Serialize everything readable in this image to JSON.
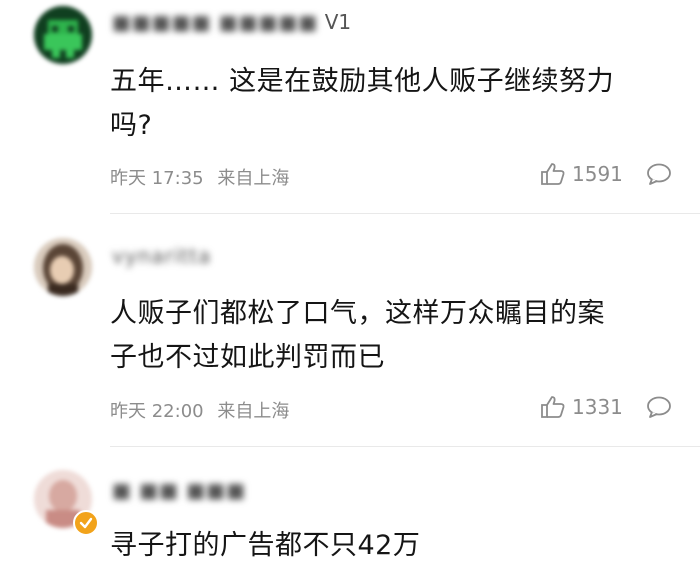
{
  "comments": [
    {
      "username_blurred": "■■■■■ ■■■■■",
      "username_suffix": "V1",
      "text_line1": "五年…… 这是在鼓励其他人贩子继续努力",
      "text_line2": "吗?",
      "time": "昨天 17:35",
      "source": "来自上海",
      "likes": "1591",
      "avatar_icon": "pixel-avatar-green"
    },
    {
      "username_blurred": "vynaritta",
      "username_suffix": "",
      "text_line1": "人贩子们都松了口气，这样万众瞩目的案",
      "text_line2": "子也不过如此判罚而已",
      "time": "昨天 22:00",
      "source": "来自上海",
      "likes": "1331",
      "avatar_icon": "photo-avatar-blurred"
    },
    {
      "username_blurred": "■ ■■ ■■■",
      "username_suffix": "",
      "text_line1": "寻子打的广告都不只42万",
      "text_line2": "",
      "avatar_icon": "photo-avatar-blurred",
      "verified_badge_color": "#f2a31b"
    }
  ],
  "icons": {
    "like": "thumbs-up-icon",
    "reply": "comment-bubble-icon"
  },
  "colors": {
    "meta_text": "#8c8c8c",
    "content_text": "#151515",
    "divider": "#e9e9e9"
  }
}
